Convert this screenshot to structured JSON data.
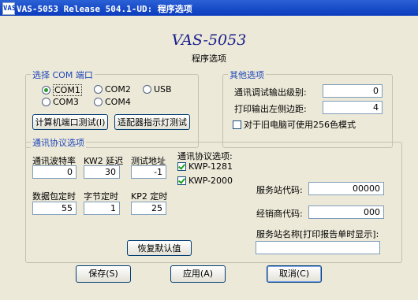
{
  "window": {
    "title": "VAS-5053 Release 504.1-UD:  程序选项",
    "app_icon": "VAS"
  },
  "header": {
    "title": "VAS-5053",
    "subtitle": "程序选项"
  },
  "com_group": {
    "legend": "选择 COM 端口",
    "options": [
      "COM1",
      "COM2",
      "USB",
      "COM3",
      "COM4"
    ],
    "selected": "COM1",
    "test_port_button": "计算机端口测试(I)",
    "test_led_button": "适配器指示灯测试"
  },
  "other_group": {
    "legend": "其他选项",
    "debug_level_label": "通讯调试输出级别:",
    "debug_level_value": "0",
    "print_margin_label": "打印输出左侧边距:",
    "print_margin_value": "4",
    "color256_label": "对于旧电脑可使用256色模式",
    "color256_checked": false
  },
  "protocol_group": {
    "legend": "通讯协议选项",
    "baud_label": "通讯波特率",
    "baud_value": "0",
    "kw2_delay_label": "KW2 延迟",
    "kw2_delay_value": "30",
    "test_addr_label": "测试地址",
    "test_addr_value": "-1",
    "packet_timing_label": "数据包定时",
    "packet_timing_value": "55",
    "byte_timing_label": "字节定时",
    "byte_timing_value": "1",
    "kp2_timing_label": "KP2 定时",
    "kp2_timing_value": "25",
    "protocols_label": "通讯协议选项:",
    "kwp1281_label": "KWP-1281",
    "kwp1281_checked": true,
    "kwp2000_label": "KWP-2000",
    "kwp2000_checked": true,
    "restore_button": "恢复默认值",
    "station_code_label": "服务站代码:",
    "station_code_value": "00000",
    "dealer_code_label": "经销商代码:",
    "dealer_code_value": "000",
    "station_name_label": "服务站名称[打印报告单时显示]:",
    "station_name_value": ""
  },
  "footer": {
    "save_button": "保存(S)",
    "apply_button": "应用(A)",
    "cancel_button": "取消(C)"
  },
  "colors": {
    "title_bar": "#0a3bbd",
    "heading": "#1a1f8c",
    "group_legend": "#2046b8",
    "window_bg": "#ece9d8"
  }
}
